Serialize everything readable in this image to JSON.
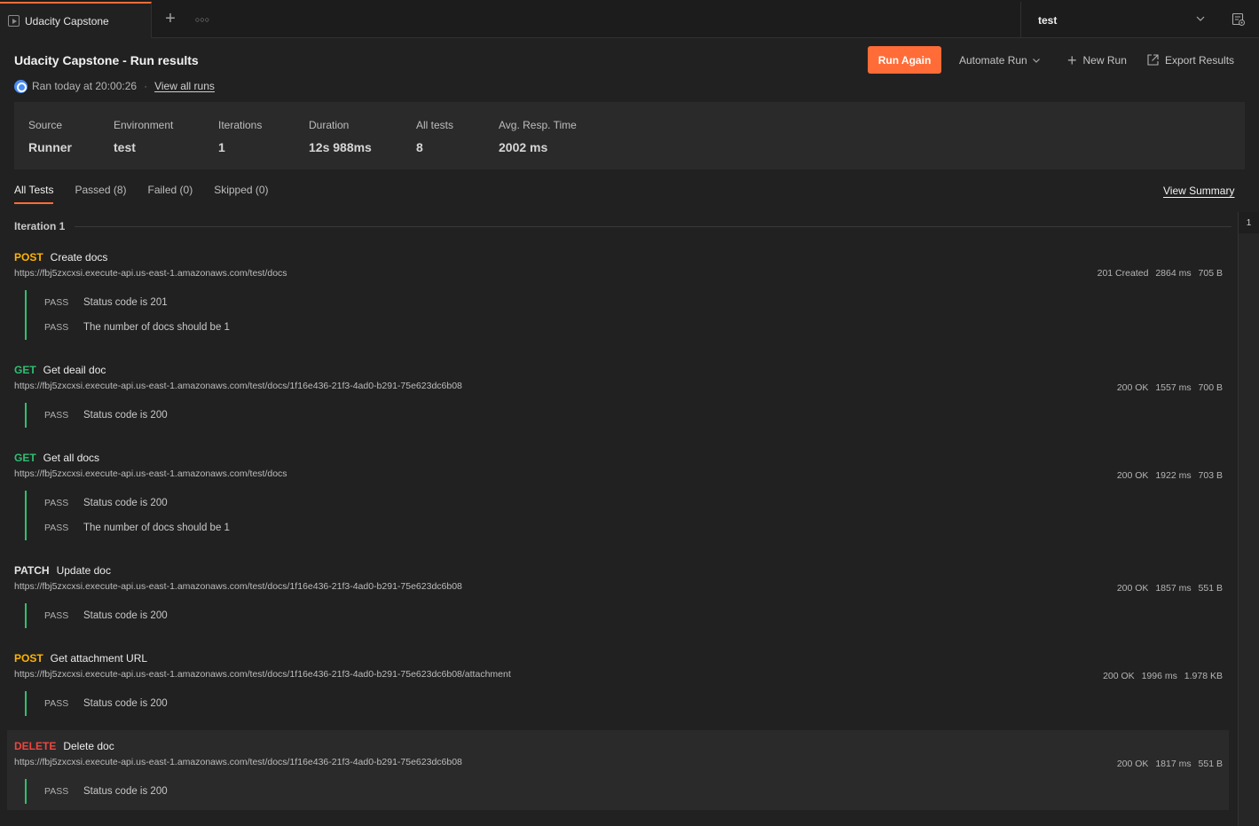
{
  "tabbar": {
    "tab_title": "Udacity Capstone",
    "environment": "test"
  },
  "header": {
    "title": "Udacity Capstone - Run results",
    "ran_at": "Ran today at 20:00:26",
    "separator": "·",
    "view_all_runs": "View all runs",
    "run_again": "Run Again",
    "automate_run": "Automate Run",
    "new_run": "New Run",
    "export_results": "Export Results"
  },
  "summary": {
    "source_label": "Source",
    "source_value": "Runner",
    "environment_label": "Environment",
    "environment_value": "test",
    "iterations_label": "Iterations",
    "iterations_value": "1",
    "duration_label": "Duration",
    "duration_value": "12s 988ms",
    "all_tests_label": "All tests",
    "all_tests_value": "8",
    "avg_resp_label": "Avg. Resp. Time",
    "avg_resp_value": "2002 ms"
  },
  "filters": {
    "all": "All Tests",
    "passed": "Passed (8)",
    "failed": "Failed (0)",
    "skipped": "Skipped (0)",
    "view_summary": "View Summary"
  },
  "iteration": {
    "label": "Iteration 1",
    "marker": "1"
  },
  "requests": [
    {
      "method": "POST",
      "name": "Create docs",
      "url": "https://fbj5zxcxsi.execute-api.us-east-1.amazonaws.com/test/docs",
      "status": "201 Created",
      "time": "2864 ms",
      "size": "705 B",
      "tests": [
        {
          "result": "PASS",
          "name": "Status code is 201"
        },
        {
          "result": "PASS",
          "name": "The number of docs should be 1"
        }
      ]
    },
    {
      "method": "GET",
      "name": "Get deail doc",
      "url": "https://fbj5zxcxsi.execute-api.us-east-1.amazonaws.com/test/docs/1f16e436-21f3-4ad0-b291-75e623dc6b08",
      "status": "200 OK",
      "time": "1557 ms",
      "size": "700 B",
      "tests": [
        {
          "result": "PASS",
          "name": "Status code is 200"
        }
      ]
    },
    {
      "method": "GET",
      "name": "Get all docs",
      "url": "https://fbj5zxcxsi.execute-api.us-east-1.amazonaws.com/test/docs",
      "status": "200 OK",
      "time": "1922 ms",
      "size": "703 B",
      "tests": [
        {
          "result": "PASS",
          "name": "Status code is 200"
        },
        {
          "result": "PASS",
          "name": "The number of docs should be 1"
        }
      ]
    },
    {
      "method": "PATCH",
      "name": "Update doc",
      "url": "https://fbj5zxcxsi.execute-api.us-east-1.amazonaws.com/test/docs/1f16e436-21f3-4ad0-b291-75e623dc6b08",
      "status": "200 OK",
      "time": "1857 ms",
      "size": "551 B",
      "tests": [
        {
          "result": "PASS",
          "name": "Status code is 200"
        }
      ]
    },
    {
      "method": "POST",
      "name": "Get attachment URL",
      "url": "https://fbj5zxcxsi.execute-api.us-east-1.amazonaws.com/test/docs/1f16e436-21f3-4ad0-b291-75e623dc6b08/attachment",
      "status": "200 OK",
      "time": "1996 ms",
      "size": "1.978 KB",
      "tests": [
        {
          "result": "PASS",
          "name": "Status code is 200"
        }
      ]
    },
    {
      "method": "DELETE",
      "name": "Delete doc",
      "url": "https://fbj5zxcxsi.execute-api.us-east-1.amazonaws.com/test/docs/1f16e436-21f3-4ad0-b291-75e623dc6b08",
      "status": "200 OK",
      "time": "1817 ms",
      "size": "551 B",
      "tests": [
        {
          "result": "PASS",
          "name": "Status code is 200"
        }
      ]
    }
  ],
  "colors": {
    "accent": "#ff6c37",
    "post": "#ffb400",
    "get": "#2fbf71",
    "delete": "#f0453f",
    "pass_bar": "#2fbf71"
  }
}
